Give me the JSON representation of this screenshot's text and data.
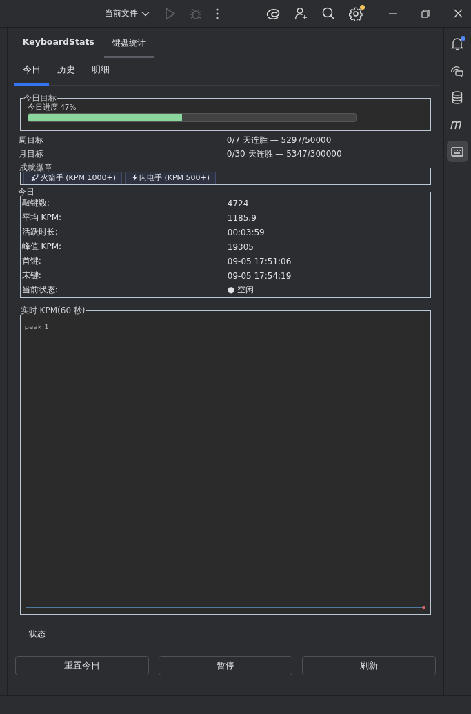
{
  "title_bar": {
    "run_config": "当前文件",
    "actions": [
      {
        "kind": "run",
        "disabled": true
      },
      {
        "kind": "debug",
        "disabled": true
      },
      {
        "kind": "more",
        "disabled": false
      }
    ],
    "tools": [
      {
        "kind": "swirl",
        "badge": false
      },
      {
        "kind": "add-user",
        "badge": false
      },
      {
        "kind": "search",
        "badge": false
      },
      {
        "kind": "settings",
        "badge": true
      }
    ]
  },
  "tool_window": {
    "title": "KeyboardStats",
    "tabs": [
      {
        "label": "键盘统计",
        "selected": true
      }
    ]
  },
  "tabs": [
    {
      "label": "今日",
      "selected": true
    },
    {
      "label": "历史",
      "selected": false
    },
    {
      "label": "明细",
      "selected": false
    }
  ],
  "daily_goal": {
    "title": "今日目标",
    "progress_label": "今日进度 47%",
    "level": 0.47
  },
  "goals": [
    {
      "label": "周目标",
      "value": "0/7 天连胜 — 5297/50000"
    },
    {
      "label": "月目标",
      "value": "0/30 天连胜 — 5347/300000"
    }
  ],
  "badges": {
    "title": "成就徽章",
    "items": [
      {
        "kind": "rocket",
        "label": "火箭手 (KPM 1000+)"
      },
      {
        "kind": "lightning",
        "label": "闪电手 (KPM 500+)"
      }
    ]
  },
  "today": {
    "title": "今日",
    "rows": [
      {
        "label": "敲键数:",
        "value": "4724"
      },
      {
        "label": "平均 KPM:",
        "value": "1185.9"
      },
      {
        "label": "活跃时长:",
        "value": "00:03:59"
      },
      {
        "label": "峰值 KPM:",
        "value": "19305"
      },
      {
        "label": "首键:",
        "value": "09-05 17:51:06"
      },
      {
        "label": "末键:",
        "value": "09-05 17:54:19"
      },
      {
        "label": "当前状态:",
        "value": "● 空闲"
      }
    ]
  },
  "chart": {
    "title": "实时 KPM(60 秒)",
    "peak_label": "peak 1"
  },
  "status_label": "状态",
  "buttons": [
    "重置今日",
    "暂停",
    "刷新"
  ],
  "right_toolbar": [
    {
      "kind": "bell",
      "selected": false,
      "badge": true
    },
    {
      "kind": "chat",
      "selected": false,
      "badge": false
    },
    {
      "kind": "database",
      "selected": false,
      "badge": false
    },
    {
      "kind": "m",
      "selected": false,
      "badge": false
    },
    {
      "kind": "keyboard",
      "selected": true,
      "badge": false
    }
  ]
}
